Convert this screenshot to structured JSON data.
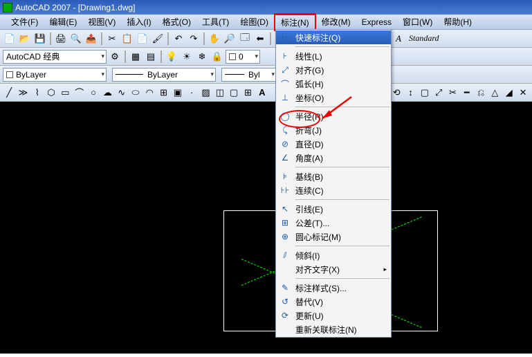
{
  "title": "AutoCAD 2007 - [Drawing1.dwg]",
  "menubar": {
    "file": "文件(F)",
    "edit": "编辑(E)",
    "view": "视图(V)",
    "insert": "插入(I)",
    "format": "格式(O)",
    "tools": "工具(T)",
    "draw": "绘图(D)",
    "dimension": "标注(N)",
    "modify": "修改(M)",
    "express": "Express",
    "window": "窗口(W)",
    "help": "帮助(H)"
  },
  "toolbar1": {
    "standard_style": "Standard"
  },
  "toolbar2": {
    "workspace": "AutoCAD 经典",
    "zero": "0"
  },
  "toolbar3": {
    "layer_color": "ByLayer",
    "linetype": "ByLayer",
    "lineweight_prefix": "Byl"
  },
  "menu": {
    "quick": "快速标注(Q)",
    "linear": "线性(L)",
    "aligned": "对齐(G)",
    "arc": "弧长(H)",
    "ordinate": "坐标(O)",
    "radius": "半径(R)",
    "jogged": "折弯(J)",
    "diameter": "直径(D)",
    "angular": "角度(A)",
    "baseline": "基线(B)",
    "continue": "连续(C)",
    "leader": "引线(E)",
    "tolerance": "公差(T)...",
    "center": "圆心标记(M)",
    "oblique": "倾斜(I)",
    "align_text": "对齐文字(X)",
    "style": "标注样式(S)...",
    "override": "替代(V)",
    "update": "更新(U)",
    "reassoc": "重新关联标注(N)"
  }
}
